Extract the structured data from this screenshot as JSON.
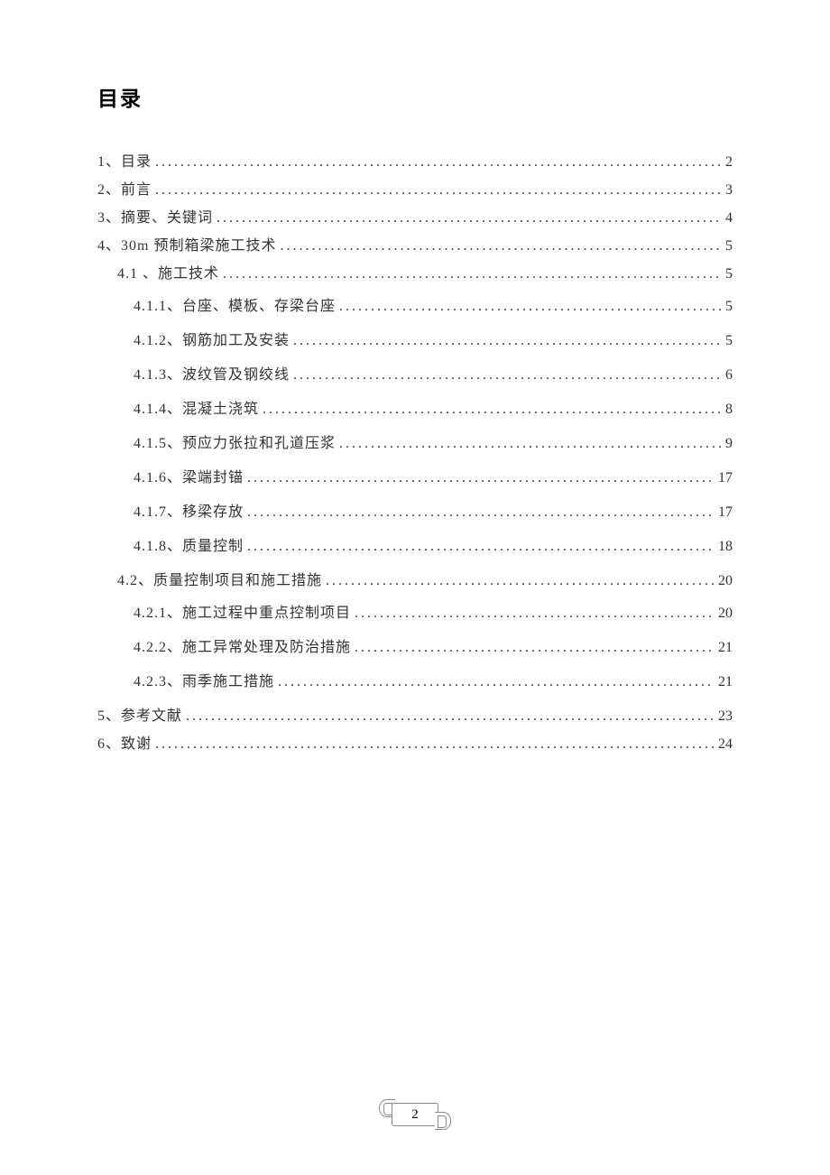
{
  "title": "目录",
  "page_number": "2",
  "toc": [
    {
      "level": 0,
      "label": "1、目录",
      "page": "2"
    },
    {
      "level": 0,
      "label": "2、前言",
      "page": "3"
    },
    {
      "level": 0,
      "label": "3、摘要、关键词",
      "page": "4"
    },
    {
      "level": 0,
      "label": "4、30m 预制箱梁施工技术 ",
      "page": "5"
    },
    {
      "level": 1,
      "label": "4.1 、施工技术",
      "page": "5"
    },
    {
      "level": 2,
      "label": "4.1.1、台座、模板、存梁台座 ",
      "page": "5"
    },
    {
      "level": 2,
      "label": "4.1.2、钢筋加工及安装 ",
      "page": "5"
    },
    {
      "level": 2,
      "label": "4.1.3、波纹管及钢绞线 ",
      "page": "6"
    },
    {
      "level": 2,
      "label": "4.1.4、混凝土浇筑 ",
      "page": "8"
    },
    {
      "level": 2,
      "label": "4.1.5、预应力张拉和孔道压浆  ",
      "page": "9"
    },
    {
      "level": 2,
      "label": "4.1.6、梁端封锚 ",
      "page": "17"
    },
    {
      "level": 2,
      "label": "4.1.7、移梁存放 ",
      "page": "17"
    },
    {
      "level": 2,
      "label": "4.1.8、质量控制 ",
      "page": "18"
    },
    {
      "level": 1,
      "label": "4.2、质量控制项目和施工措施",
      "page": "20"
    },
    {
      "level": 2,
      "label": "4.2.1、施工过程中重点控制项目 ",
      "page": "20"
    },
    {
      "level": 2,
      "label": "4.2.2、施工异常处理及防治措施 ",
      "page": "21"
    },
    {
      "level": 2,
      "label": "4.2.3、雨季施工措施 ",
      "page": "21"
    },
    {
      "level": 0,
      "label": "5、参考文献",
      "page": "23"
    },
    {
      "level": 0,
      "label": "6、致谢",
      "page": "24"
    }
  ]
}
